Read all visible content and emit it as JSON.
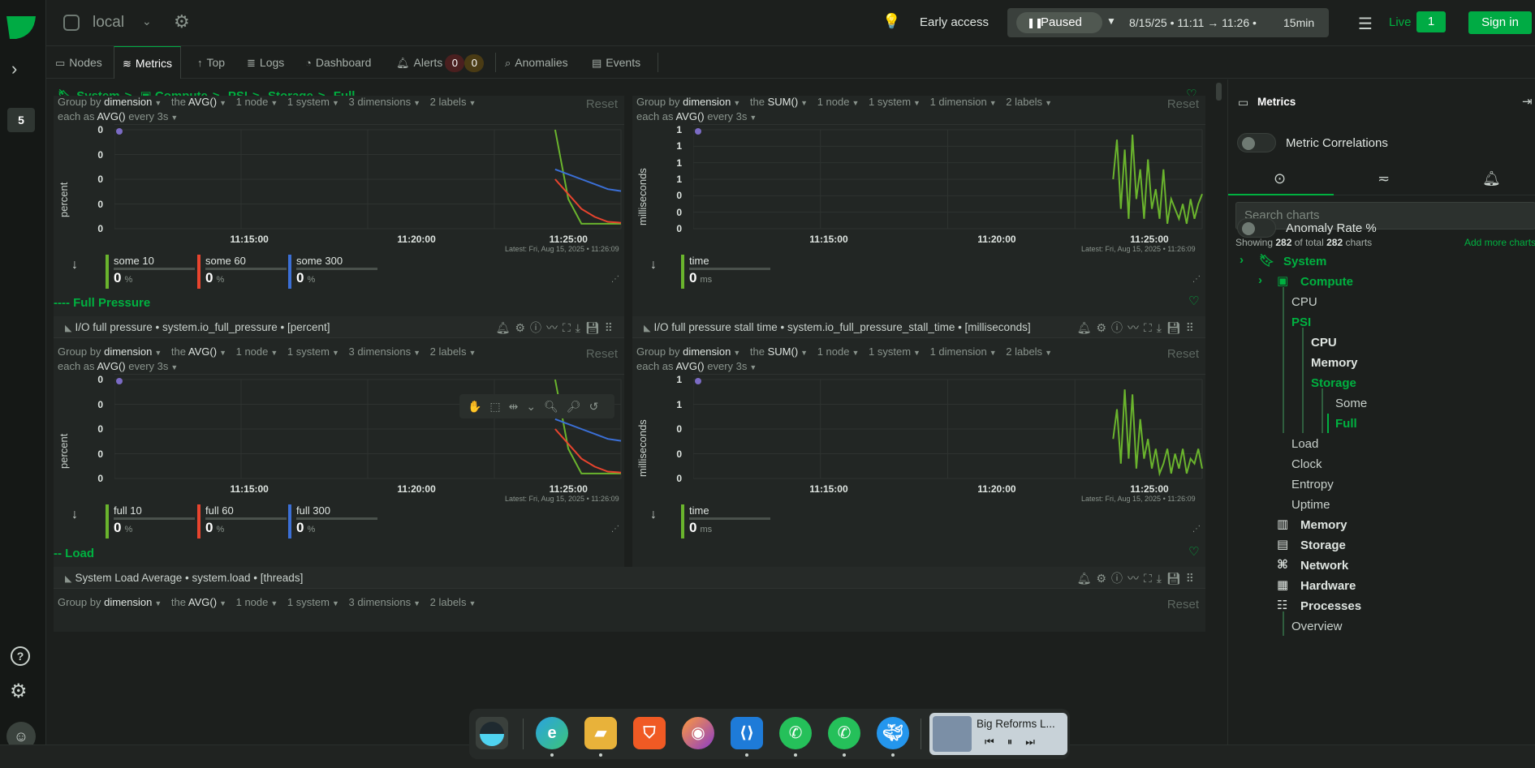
{
  "topbar": {
    "space_name": "local",
    "early_access": "Early access",
    "paused_label": "Paused",
    "time_range": "8/15/25 • 11:11 → 11:26 •",
    "duration": "15min",
    "live_label": "Live",
    "live_count": "1",
    "signin_label": "Sign in"
  },
  "rail": {
    "space_badge": "5",
    "help": "?"
  },
  "tabs": [
    {
      "label": "Nodes",
      "icon": "nodes-icon"
    },
    {
      "label": "Metrics",
      "icon": "metrics-icon"
    },
    {
      "label": "Top",
      "icon": "top-icon"
    },
    {
      "label": "Logs",
      "icon": "logs-icon"
    },
    {
      "label": "Dashboard",
      "icon": "dashboard-icon"
    },
    {
      "label": "Alerts",
      "icon": "bell-icon"
    },
    {
      "label": "Anomalies",
      "icon": "anomalies-icon"
    },
    {
      "label": "Events",
      "icon": "events-icon"
    }
  ],
  "alerts": {
    "critical": "0",
    "warning": "0"
  },
  "breadcrumb": [
    "System",
    "Compute",
    "PSI",
    "Storage",
    "Full"
  ],
  "breadcrumb_sep": ">",
  "sections": {
    "full_pressure": "---- Full Pressure",
    "load": "-- Load"
  },
  "common": {
    "group_by": "Group by",
    "dimension": "dimension",
    "the": "the",
    "one_node": "1 node",
    "one_system": "1 system",
    "two_labels": "2 labels",
    "each_as": "each as",
    "every": "every 3s",
    "reset": "Reset",
    "latest": "Latest: Fri, Aug 15, 2025 • 11:26:09"
  },
  "panels": {
    "p1": {
      "agg": "AVG()",
      "dims": "3 dimensions",
      "each": "AVG()",
      "ylabel": "percent",
      "legend": [
        {
          "name": "some 10",
          "value": "0",
          "unit": "%"
        },
        {
          "name": "some 60",
          "value": "0",
          "unit": "%"
        },
        {
          "name": "some 300",
          "value": "0",
          "unit": "%"
        }
      ]
    },
    "p2": {
      "agg": "SUM()",
      "dims": "1 dimension",
      "each": "AVG()",
      "ylabel": "milliseconds",
      "legend": [
        {
          "name": "time",
          "value": "0",
          "unit": "ms"
        }
      ]
    },
    "p3": {
      "title": "I/O full pressure • system.io_full_pressure • [percent]",
      "agg": "AVG()",
      "dims": "3 dimensions",
      "each": "AVG()",
      "ylabel": "percent",
      "legend": [
        {
          "name": "full 10",
          "value": "0",
          "unit": "%"
        },
        {
          "name": "full 60",
          "value": "0",
          "unit": "%"
        },
        {
          "name": "full 300",
          "value": "0",
          "unit": "%"
        }
      ]
    },
    "p4": {
      "title": "I/O full pressure stall time • system.io_full_pressure_stall_time • [milliseconds]",
      "agg": "SUM()",
      "dims": "1 dimension",
      "each": "AVG()",
      "ylabel": "milliseconds",
      "legend": [
        {
          "name": "time",
          "value": "0",
          "unit": "ms"
        }
      ]
    },
    "p5": {
      "title": "System Load Average • system.load • [threads]",
      "agg": "AVG()",
      "dims": "3 dimensions"
    }
  },
  "chart_data": [
    {
      "type": "line",
      "title": "",
      "ylabel": "percent",
      "x_ticks": [
        "11:15:00",
        "11:20:00",
        "11:25:00"
      ],
      "y_ticks": [
        "0",
        "0",
        "0",
        "0",
        "0"
      ],
      "x": [
        "11:24:00",
        "11:24:30",
        "11:25:00",
        "11:25:30",
        "11:26:00",
        "11:26:09"
      ],
      "series": [
        {
          "name": "some 10",
          "color": "#6ab42d",
          "values": [
            1.0,
            0.3,
            0.05,
            0.05,
            0.05,
            0.05
          ]
        },
        {
          "name": "some 60",
          "color": "#e8442e",
          "values": [
            0.5,
            0.35,
            0.2,
            0.12,
            0.07,
            0.06
          ]
        },
        {
          "name": "some 300",
          "color": "#3b6fd6",
          "values": [
            0.6,
            0.55,
            0.5,
            0.45,
            0.4,
            0.38
          ]
        }
      ]
    },
    {
      "type": "line",
      "title": "",
      "ylabel": "milliseconds",
      "x_ticks": [
        "11:15:00",
        "11:20:00",
        "11:25:00"
      ],
      "y_ticks": [
        "1",
        "1",
        "1",
        "1",
        "0",
        "0",
        "0"
      ],
      "series": [
        {
          "name": "time",
          "color": "#6ab42d",
          "values": [
            0.5,
            0.9,
            0.2,
            0.8,
            0.1,
            0.95,
            0.3,
            0.6,
            0.1,
            0.7,
            0.2,
            0.4,
            0.1,
            0.6,
            0.05,
            0.3,
            0.2,
            0.1,
            0.25,
            0.05,
            0.3,
            0.1,
            0.25,
            0.35
          ]
        }
      ]
    },
    {
      "type": "line",
      "title": "",
      "ylabel": "percent",
      "x_ticks": [
        "11:15:00",
        "11:20:00",
        "11:25:00"
      ],
      "y_ticks": [
        "0",
        "0",
        "0",
        "0",
        "0"
      ],
      "x": [
        "11:24:00",
        "11:24:30",
        "11:25:00",
        "11:25:30",
        "11:26:00",
        "11:26:09"
      ],
      "series": [
        {
          "name": "full 10",
          "color": "#6ab42d",
          "values": [
            1.0,
            0.3,
            0.05,
            0.05,
            0.05,
            0.05
          ]
        },
        {
          "name": "full 60",
          "color": "#e8442e",
          "values": [
            0.5,
            0.35,
            0.2,
            0.12,
            0.07,
            0.06
          ]
        },
        {
          "name": "full 300",
          "color": "#3b6fd6",
          "values": [
            0.6,
            0.55,
            0.5,
            0.45,
            0.4,
            0.38
          ]
        }
      ]
    },
    {
      "type": "line",
      "title": "",
      "ylabel": "milliseconds",
      "x_ticks": [
        "11:15:00",
        "11:20:00",
        "11:25:00"
      ],
      "y_ticks": [
        "1",
        "1",
        "0",
        "0",
        "0"
      ],
      "series": [
        {
          "name": "time",
          "color": "#6ab42d",
          "values": [
            0.4,
            0.7,
            0.15,
            0.9,
            0.2,
            0.85,
            0.1,
            0.6,
            0.2,
            0.4,
            0.1,
            0.3,
            0.05,
            0.15,
            0.3,
            0.05,
            0.25,
            0.1,
            0.3,
            0.05,
            0.2,
            0.15,
            0.3,
            0.1
          ]
        }
      ]
    }
  ],
  "sidebar": {
    "title": "Metrics",
    "metric_correlations": "Metric Correlations",
    "search_placeholder": "Search charts",
    "showing_prefix": "Showing",
    "shown": "282",
    "showing_mid": "of total",
    "total": "282",
    "showing_suffix": "charts",
    "add_more": "Add more charts",
    "anomaly_rate": "Anomaly Rate %",
    "tree": {
      "system": "System",
      "compute": "Compute",
      "cpu": "CPU",
      "psi": "PSI",
      "psi_cpu": "CPU",
      "psi_memory": "Memory",
      "psi_storage": "Storage",
      "some": "Some",
      "full": "Full",
      "load": "Load",
      "clock": "Clock",
      "entropy": "Entropy",
      "uptime": "Uptime",
      "memory": "Memory",
      "storage": "Storage",
      "network": "Network",
      "hardware": "Hardware",
      "processes": "Processes",
      "overview": "Overview"
    }
  },
  "dock": {
    "media_title": "Big Reforms L...",
    "apps": [
      "Edge",
      "Files",
      "Brave",
      "Firefox",
      "VS Code",
      "WhatsApp",
      "WhatsApp",
      "Docker"
    ]
  }
}
